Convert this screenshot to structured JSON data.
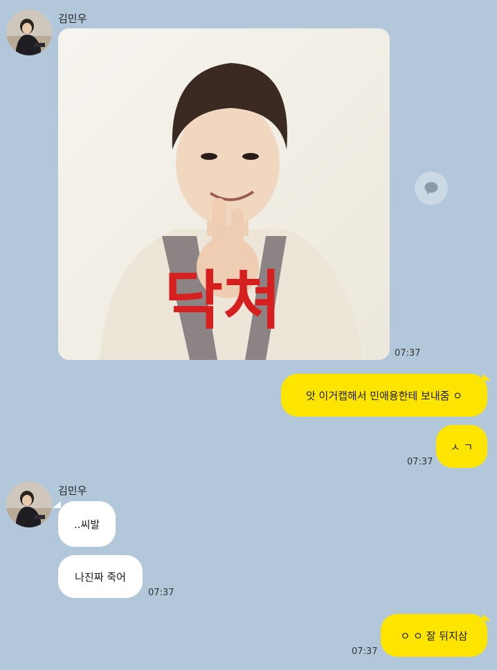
{
  "chat": {
    "sender_name": "김민우",
    "photo": {
      "caption": "닥쳐",
      "caption_color": "#d61f1f"
    },
    "share_button_icon": "speech-bubble-icon",
    "messages": [
      {
        "text": "앗 이거캡해서 민애용한테 보내줌 ㅇ"
      },
      {
        "text": "ㅅ ㄱ"
      },
      {
        "text": "..씨발"
      },
      {
        "text": "나진짜 죽어"
      },
      {
        "text": "ㅇ ㅇ 잘 뒤지삼"
      }
    ],
    "times": {
      "photo": "07:37",
      "sent_group1": "07:37",
      "recv_group2": "07:37",
      "sent_group3": "07:37"
    }
  },
  "colors": {
    "background": "#b2c7da",
    "sent_bubble": "#fee500",
    "received_bubble": "#ffffff"
  }
}
